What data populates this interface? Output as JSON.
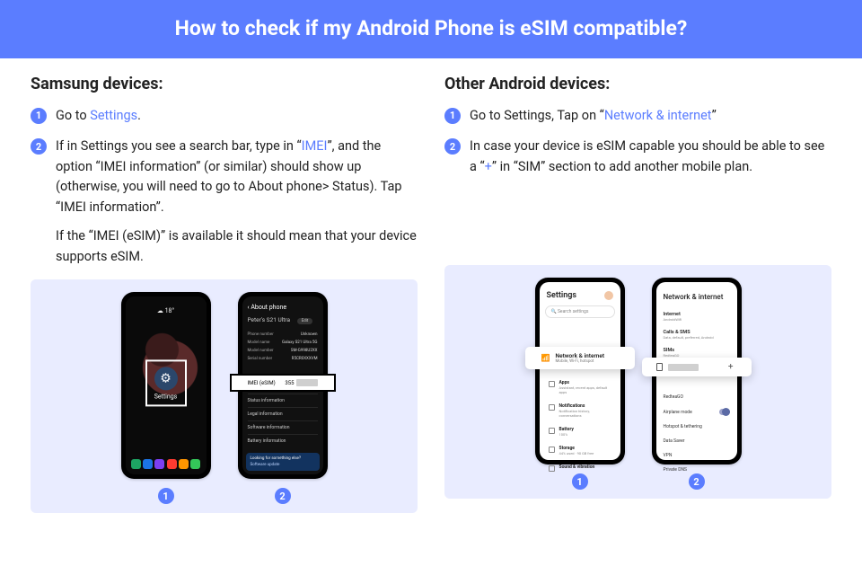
{
  "hero": "How to check if my Android Phone is eSIM compatible?",
  "left": {
    "title": "Samsung devices:",
    "step1_a": "Go to ",
    "step1_kw": "Settings",
    "step1_b": ".",
    "step2_a": "If in Settings you see a search bar, type in “",
    "step2_kw": "IMEI",
    "step2_b": "”, and the option “IMEI information” (or similar) should show up (otherwise, you will need to go to About phone> Status). Tap “IMEI information”.",
    "step2_extra": "If the “IMEI (eSIM)” is available it should mean that your device supports eSIM.",
    "shot1": {
      "weather": "☁ 18°",
      "settings_label": "Settings"
    },
    "shot2": {
      "header": "‹  About phone",
      "device": "Peter's S21 Ultra",
      "edit": "Edit",
      "rows": {
        "phone_k": "Phone number",
        "phone_v": "Unknown",
        "model_k": "Model name",
        "model_v": "Galaxy S21 Ultra 5G",
        "modelnum_k": "Model number",
        "modelnum_v": "SM-G998U2XX",
        "serial_k": "Serial number",
        "serial_v": "R5CR0XXXVM"
      },
      "imei_label": "IMEI (eSIM)",
      "imei_prefix": "355",
      "list": {
        "a": "Status information",
        "b": "Legal information",
        "c": "Software information",
        "d": "Battery information"
      },
      "foot_q": "Looking for something else?",
      "foot_link": "Software update"
    },
    "badge1": "1",
    "badge2": "2"
  },
  "right": {
    "title": "Other Android devices:",
    "step1_a": "Go to Settings, Tap on “",
    "step1_kw": "Network & internet",
    "step1_b": "”",
    "step2_a": "In case your device is eSIM capable you should be able to see a “",
    "step2_kw": "+",
    "step2_b": "” in “SIM” section to add another mobile plan.",
    "shot1": {
      "title": "Settings",
      "search": "🔍  Search settings",
      "pop_title": "Network & internet",
      "pop_sub": "Mobile, Wi-Fi, hotspot",
      "items": {
        "a": "Apps",
        "as": "Assistant, recent apps, default apps",
        "b": "Notifications",
        "bs": "Notification history, conversations",
        "c": "Battery",
        "cs": "100%",
        "d": "Storage",
        "ds": "44% used · 90 GB free",
        "e": "Sound & vibration"
      }
    },
    "shot2": {
      "title": "Network & internet",
      "r1": "Internet",
      "r1s": "AndroidWifi",
      "r2": "Calls & SMS",
      "r2s": "Data, default, preferred, Android",
      "sims": "SIMs",
      "sims_sub": "RedteaGO",
      "plus": "+",
      "m1": "RedteaGO",
      "m2": "Airplane mode",
      "m3": "Hotspot & tethering",
      "m4": "Data Saver",
      "m5": "VPN",
      "m6": "Private DNS"
    },
    "badge1": "1",
    "badge2": "2"
  }
}
